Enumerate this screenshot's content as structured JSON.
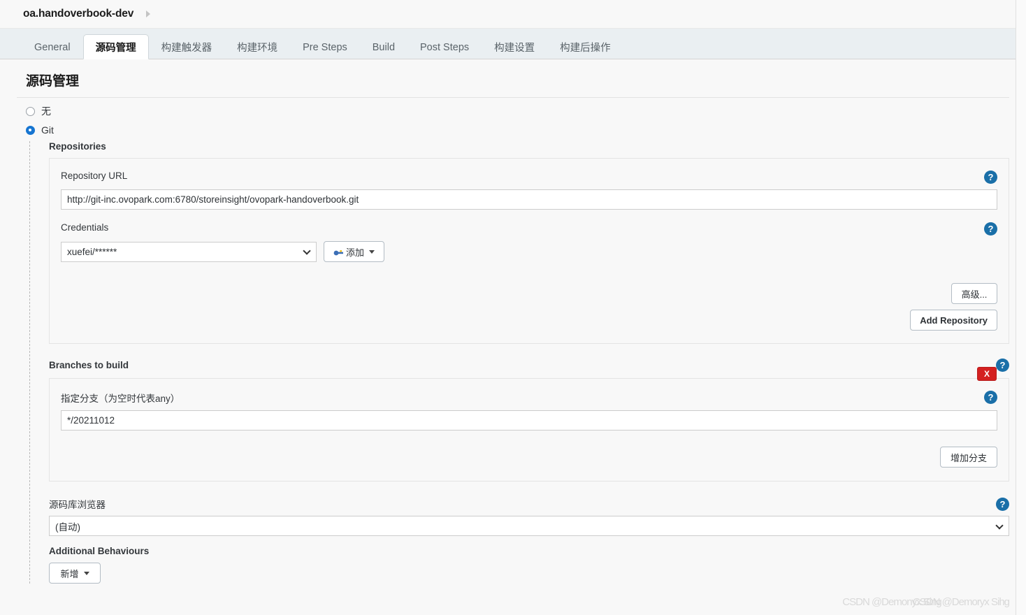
{
  "breadcrumb": {
    "title": "oa.handoverbook-dev",
    "caret_icon": "triangle-right-icon"
  },
  "tabs": [
    {
      "label": "General",
      "active": false
    },
    {
      "label": "源码管理",
      "active": true
    },
    {
      "label": "构建触发器",
      "active": false
    },
    {
      "label": "构建环境",
      "active": false
    },
    {
      "label": "Pre Steps",
      "active": false
    },
    {
      "label": "Build",
      "active": false
    },
    {
      "label": "Post Steps",
      "active": false
    },
    {
      "label": "构建设置",
      "active": false
    },
    {
      "label": "构建后操作",
      "active": false
    }
  ],
  "section": {
    "title": "源码管理"
  },
  "scm_options": [
    {
      "label": "无",
      "checked": false
    },
    {
      "label": "Git",
      "checked": true
    }
  ],
  "repositories": {
    "label": "Repositories",
    "url_label": "Repository URL",
    "url_value": "http://git-inc.ovopark.com:6780/storeinsight/ovopark-handoverbook.git",
    "credentials_label": "Credentials",
    "credentials_value": "xuefei/******",
    "add_credentials_label": "添加",
    "advanced_label": "高级...",
    "add_repository_label": "Add Repository"
  },
  "branches": {
    "label": "Branches to build",
    "specifier_label": "指定分支（为空时代表any）",
    "specifier_value": "*/20211012",
    "delete_label": "X",
    "add_branch_label": "增加分支"
  },
  "browser": {
    "label": "源码库浏览器",
    "value": "(自动)"
  },
  "additional": {
    "label": "Additional Behaviours",
    "add_label": "新增"
  },
  "help_icon": "?",
  "watermark": {
    "front": "CSDN @Demonyx.Sing",
    "back": "CSDN @Demoryx Sihg"
  },
  "colors": {
    "accent": "#1675d1",
    "help_blue": "#1a6fa8",
    "danger": "#d42020",
    "page_bg": "#f8f8f8",
    "tabbar_bg": "#eaeff2"
  }
}
